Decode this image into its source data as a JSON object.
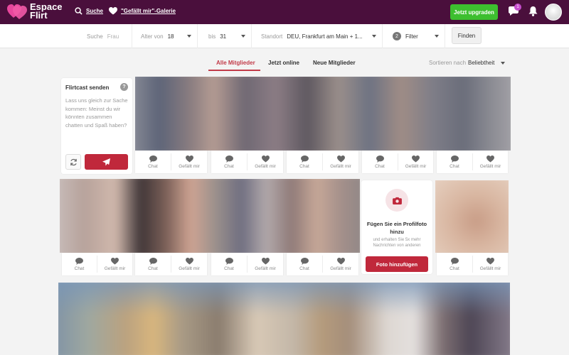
{
  "header": {
    "logo_line1": "Espace",
    "logo_line2": "Flirt",
    "search_link": "Suche",
    "gallery_link": "\"Gefällt mir\"-Galerie",
    "upgrade_label": "Jetzt upgraden",
    "message_count": "1",
    "icons": [
      "search-icon",
      "heart-icon",
      "chat-bubble-icon",
      "bell-icon",
      "avatar"
    ]
  },
  "search": {
    "search_label": "Suche",
    "search_placeholder": "Frau",
    "age_from_label": "Alter von",
    "age_from_value": "18",
    "age_to_label": "bis",
    "age_to_value": "31",
    "location_label": "Standort",
    "location_value": "DEU, Frankfurt am Main + 1...",
    "filter_count": "2",
    "filter_label": "Filter",
    "find_label": "Finden"
  },
  "tabs": [
    {
      "label": "Alle Mitglieder",
      "active": true
    },
    {
      "label": "Jetzt online",
      "active": false
    },
    {
      "label": "Neue Mitglieder",
      "active": false
    }
  ],
  "sort": {
    "label": "Sortieren nach",
    "value": "Beliebtheit"
  },
  "flirtcast": {
    "title": "Flirtcast senden",
    "help": "?",
    "text": "Lass uns gleich zur Sache kommen: Meinst du wir könnten zusammen chatten und Spaß haben?"
  },
  "actions": {
    "chat": "Chat",
    "like": "Gefällt mir"
  },
  "add_photo": {
    "title": "Fügen Sie ein Profilfoto hinzu",
    "subtitle": "und erhalten Sie 5x mehr Nachrichten von anderen",
    "button": "Foto hinzufügen"
  },
  "colors": {
    "header_bg": "#4a0f3c",
    "accent": "#c0283b",
    "upgrade_green": "#3dbf2f"
  }
}
